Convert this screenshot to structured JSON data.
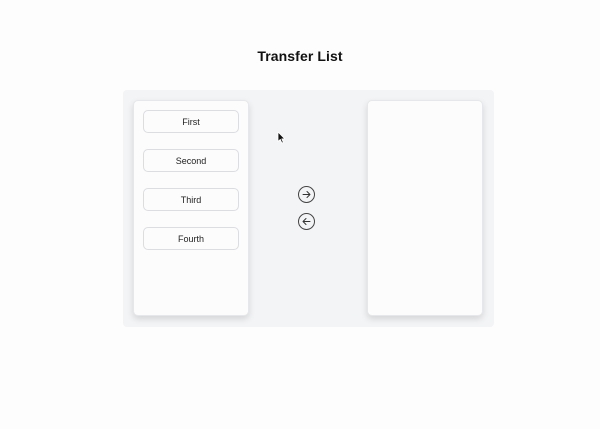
{
  "header": {
    "title": "Transfer List"
  },
  "left_list": {
    "items": [
      {
        "label": "First"
      },
      {
        "label": "Second"
      },
      {
        "label": "Third"
      },
      {
        "label": "Fourth"
      }
    ]
  },
  "right_list": {
    "items": []
  },
  "controls": {
    "move_right_icon": "arrow-right-icon",
    "move_left_icon": "arrow-left-icon"
  },
  "colors": {
    "stage_background": "#f3f4f6",
    "panel_background": "#fcfcfc",
    "item_border": "#dcdde1"
  }
}
